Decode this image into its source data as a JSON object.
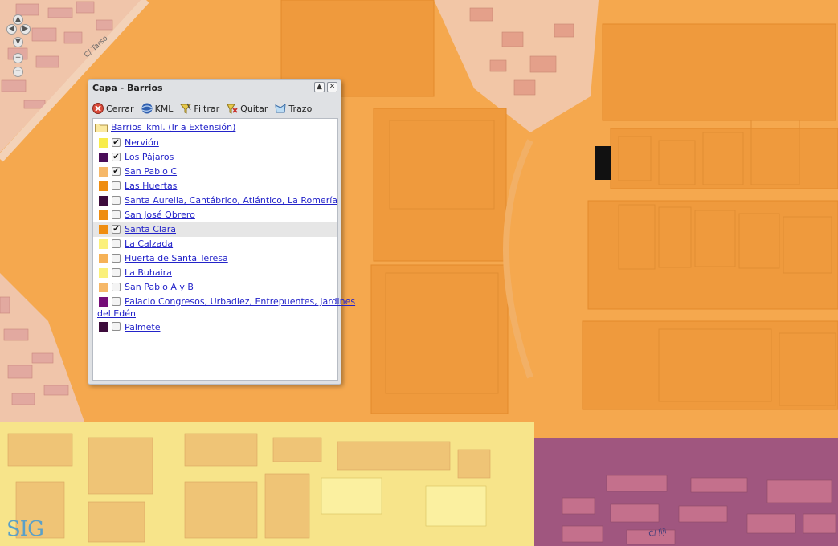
{
  "panel": {
    "title": "Capa - Barrios",
    "toolbar": [
      {
        "label": "Cerrar",
        "icon": "close-layer-icon"
      },
      {
        "label": "KML",
        "icon": "globe-icon"
      },
      {
        "label": "Filtrar",
        "icon": "filter-icon"
      },
      {
        "label": "Quitar",
        "icon": "remove-icon"
      },
      {
        "label": "Trazo",
        "icon": "stroke-icon"
      }
    ],
    "root_label": "Barrios_kml. (Ir a Extensión)",
    "items": [
      {
        "label": "Nervión",
        "color": "#f8ec4a",
        "checked": true
      },
      {
        "label": "Los Pájaros",
        "color": "#4a0d58",
        "checked": true
      },
      {
        "label": "San Pablo C",
        "color": "#f6b868",
        "checked": true
      },
      {
        "label": "Las Huertas",
        "color": "#ef8d10",
        "checked": false
      },
      {
        "label": "Santa Aurelia, Cantábrico, Atlántico, La Romería",
        "color": "#3d0c3c",
        "checked": false
      },
      {
        "label": "San José Obrero",
        "color": "#ef8d10",
        "checked": false
      },
      {
        "label": "Santa Clara",
        "color": "#ef8d10",
        "checked": true,
        "selected": true
      },
      {
        "label": "La Calzada",
        "color": "#fbf07a",
        "checked": false
      },
      {
        "label": "Huerta de Santa Teresa",
        "color": "#f6b257",
        "checked": false
      },
      {
        "label": "La Buhaira",
        "color": "#faf07a",
        "checked": false
      },
      {
        "label": "San Pablo A y B",
        "color": "#f6b868",
        "checked": false
      },
      {
        "label": "Palacio Congresos, Urbadiez, Entrepuentes, Jardines",
        "label_cont": "del Edén",
        "color": "#760d78",
        "checked": false
      },
      {
        "label": "Palmete",
        "color": "#3d0c3c",
        "checked": false
      }
    ]
  },
  "map": {
    "street_labels": [
      "C/ Tarso",
      "C/ Jiji"
    ],
    "logo": "SIG"
  }
}
